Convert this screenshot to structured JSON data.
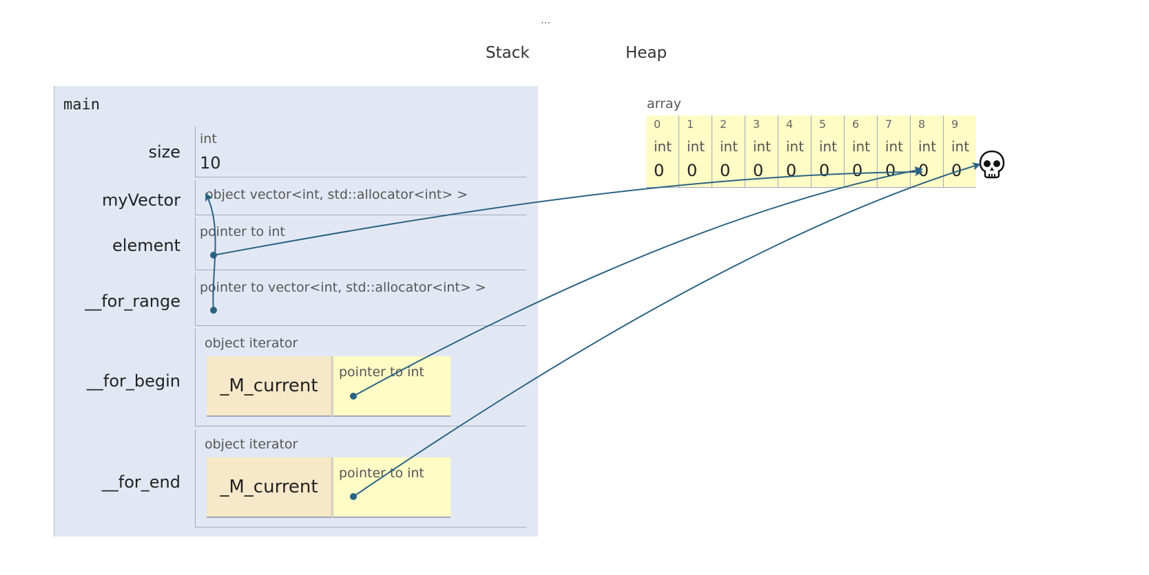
{
  "ellipsis": "…",
  "headers": {
    "stack": "Stack",
    "heap": "Heap"
  },
  "frame": {
    "name": "main",
    "variables": {
      "size": {
        "name": "size",
        "type": "int",
        "value": "10"
      },
      "myVector": {
        "name": "myVector",
        "type": "object vector<int, std::allocator<int> >"
      },
      "element": {
        "name": "element",
        "type": "pointer to int"
      },
      "for_range": {
        "name": "__for_range",
        "type": "pointer to vector<int, std::allocator<int> >"
      },
      "for_begin": {
        "name": "__for_begin",
        "type": "object iterator",
        "field": "_M_current",
        "field_type": "pointer to int"
      },
      "for_end": {
        "name": "__for_end",
        "type": "object iterator",
        "field": "_M_current",
        "field_type": "pointer to int"
      }
    }
  },
  "heap": {
    "label": "array",
    "cells": [
      {
        "index": "0",
        "type": "int",
        "value": "0"
      },
      {
        "index": "1",
        "type": "int",
        "value": "0"
      },
      {
        "index": "2",
        "type": "int",
        "value": "0"
      },
      {
        "index": "3",
        "type": "int",
        "value": "0"
      },
      {
        "index": "4",
        "type": "int",
        "value": "0"
      },
      {
        "index": "5",
        "type": "int",
        "value": "0"
      },
      {
        "index": "6",
        "type": "int",
        "value": "0"
      },
      {
        "index": "7",
        "type": "int",
        "value": "0"
      },
      {
        "index": "8",
        "type": "int",
        "value": "0"
      },
      {
        "index": "9",
        "type": "int",
        "value": "0"
      }
    ],
    "end_marker_icon": "skull-icon"
  },
  "colors": {
    "stack_bg": "#e2e8f3",
    "heap_bg": "#fffcc6",
    "iterator_bg": "#f6e8c8",
    "arrow": "#2a6283"
  }
}
